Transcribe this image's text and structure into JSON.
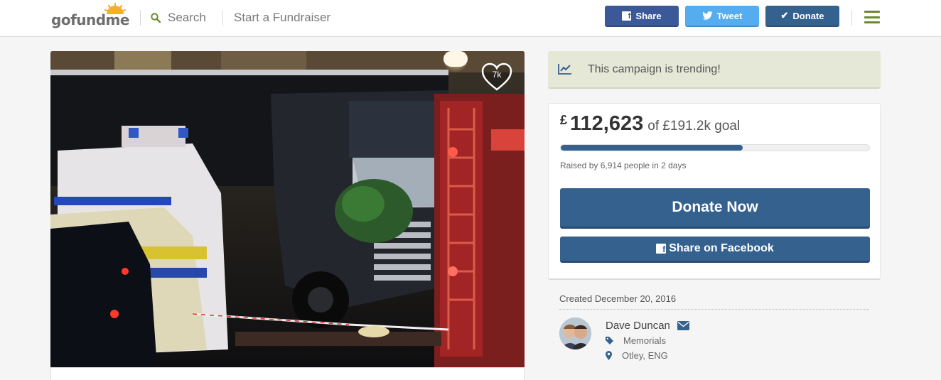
{
  "header": {
    "logo": "gofundme",
    "search_label": "Search",
    "start_label": "Start a Fundraiser",
    "share_label": "Share",
    "tweet_label": "Tweet",
    "donate_label": "Donate",
    "colors": {
      "facebook": "#3b5998",
      "twitter": "#55acee",
      "donate": "#35618f",
      "accent": "#6b8a2b"
    }
  },
  "photo": {
    "likes": "7k"
  },
  "trending": {
    "text": "This campaign is trending!"
  },
  "funding": {
    "currency": "£",
    "raised": "112,623",
    "goal_text": "of £191.2k goal",
    "progress_fraction": 0.589,
    "raised_by": "Raised by 6,914 people in 2 days",
    "donate_now": "Donate Now",
    "share_facebook": "Share on Facebook"
  },
  "organizer": {
    "created": "Created December 20, 2016",
    "name": "Dave Duncan",
    "category": "Memorials",
    "location": "Otley, ENG"
  }
}
